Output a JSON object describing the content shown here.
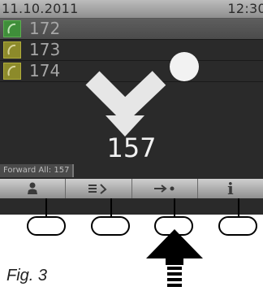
{
  "status_bar": {
    "date": "11.10.2011",
    "time": "12:30"
  },
  "lines": [
    {
      "label": "172",
      "state": "selected",
      "icon": "handset-icon"
    },
    {
      "label": "173",
      "state": "normal",
      "icon": "handset-icon"
    },
    {
      "label": "174",
      "state": "normal",
      "icon": "handset-icon"
    }
  ],
  "forward": {
    "number": "157",
    "status_text": "Forward All: 157",
    "icon": "call-forward-icon"
  },
  "softkeys": [
    {
      "icon": "person-icon"
    },
    {
      "icon": "menu-return-icon"
    },
    {
      "icon": "forward-dot-icon"
    },
    {
      "icon": "info-icon",
      "glyph": "i"
    }
  ],
  "figure": {
    "label": "Fig. 3"
  },
  "colors": {
    "screen_bg": "#2a2a2a",
    "line_icon_selected": "#3f8e3a",
    "line_icon_normal": "#8c8a2a",
    "softkey_bar": "#b0b0b0"
  }
}
